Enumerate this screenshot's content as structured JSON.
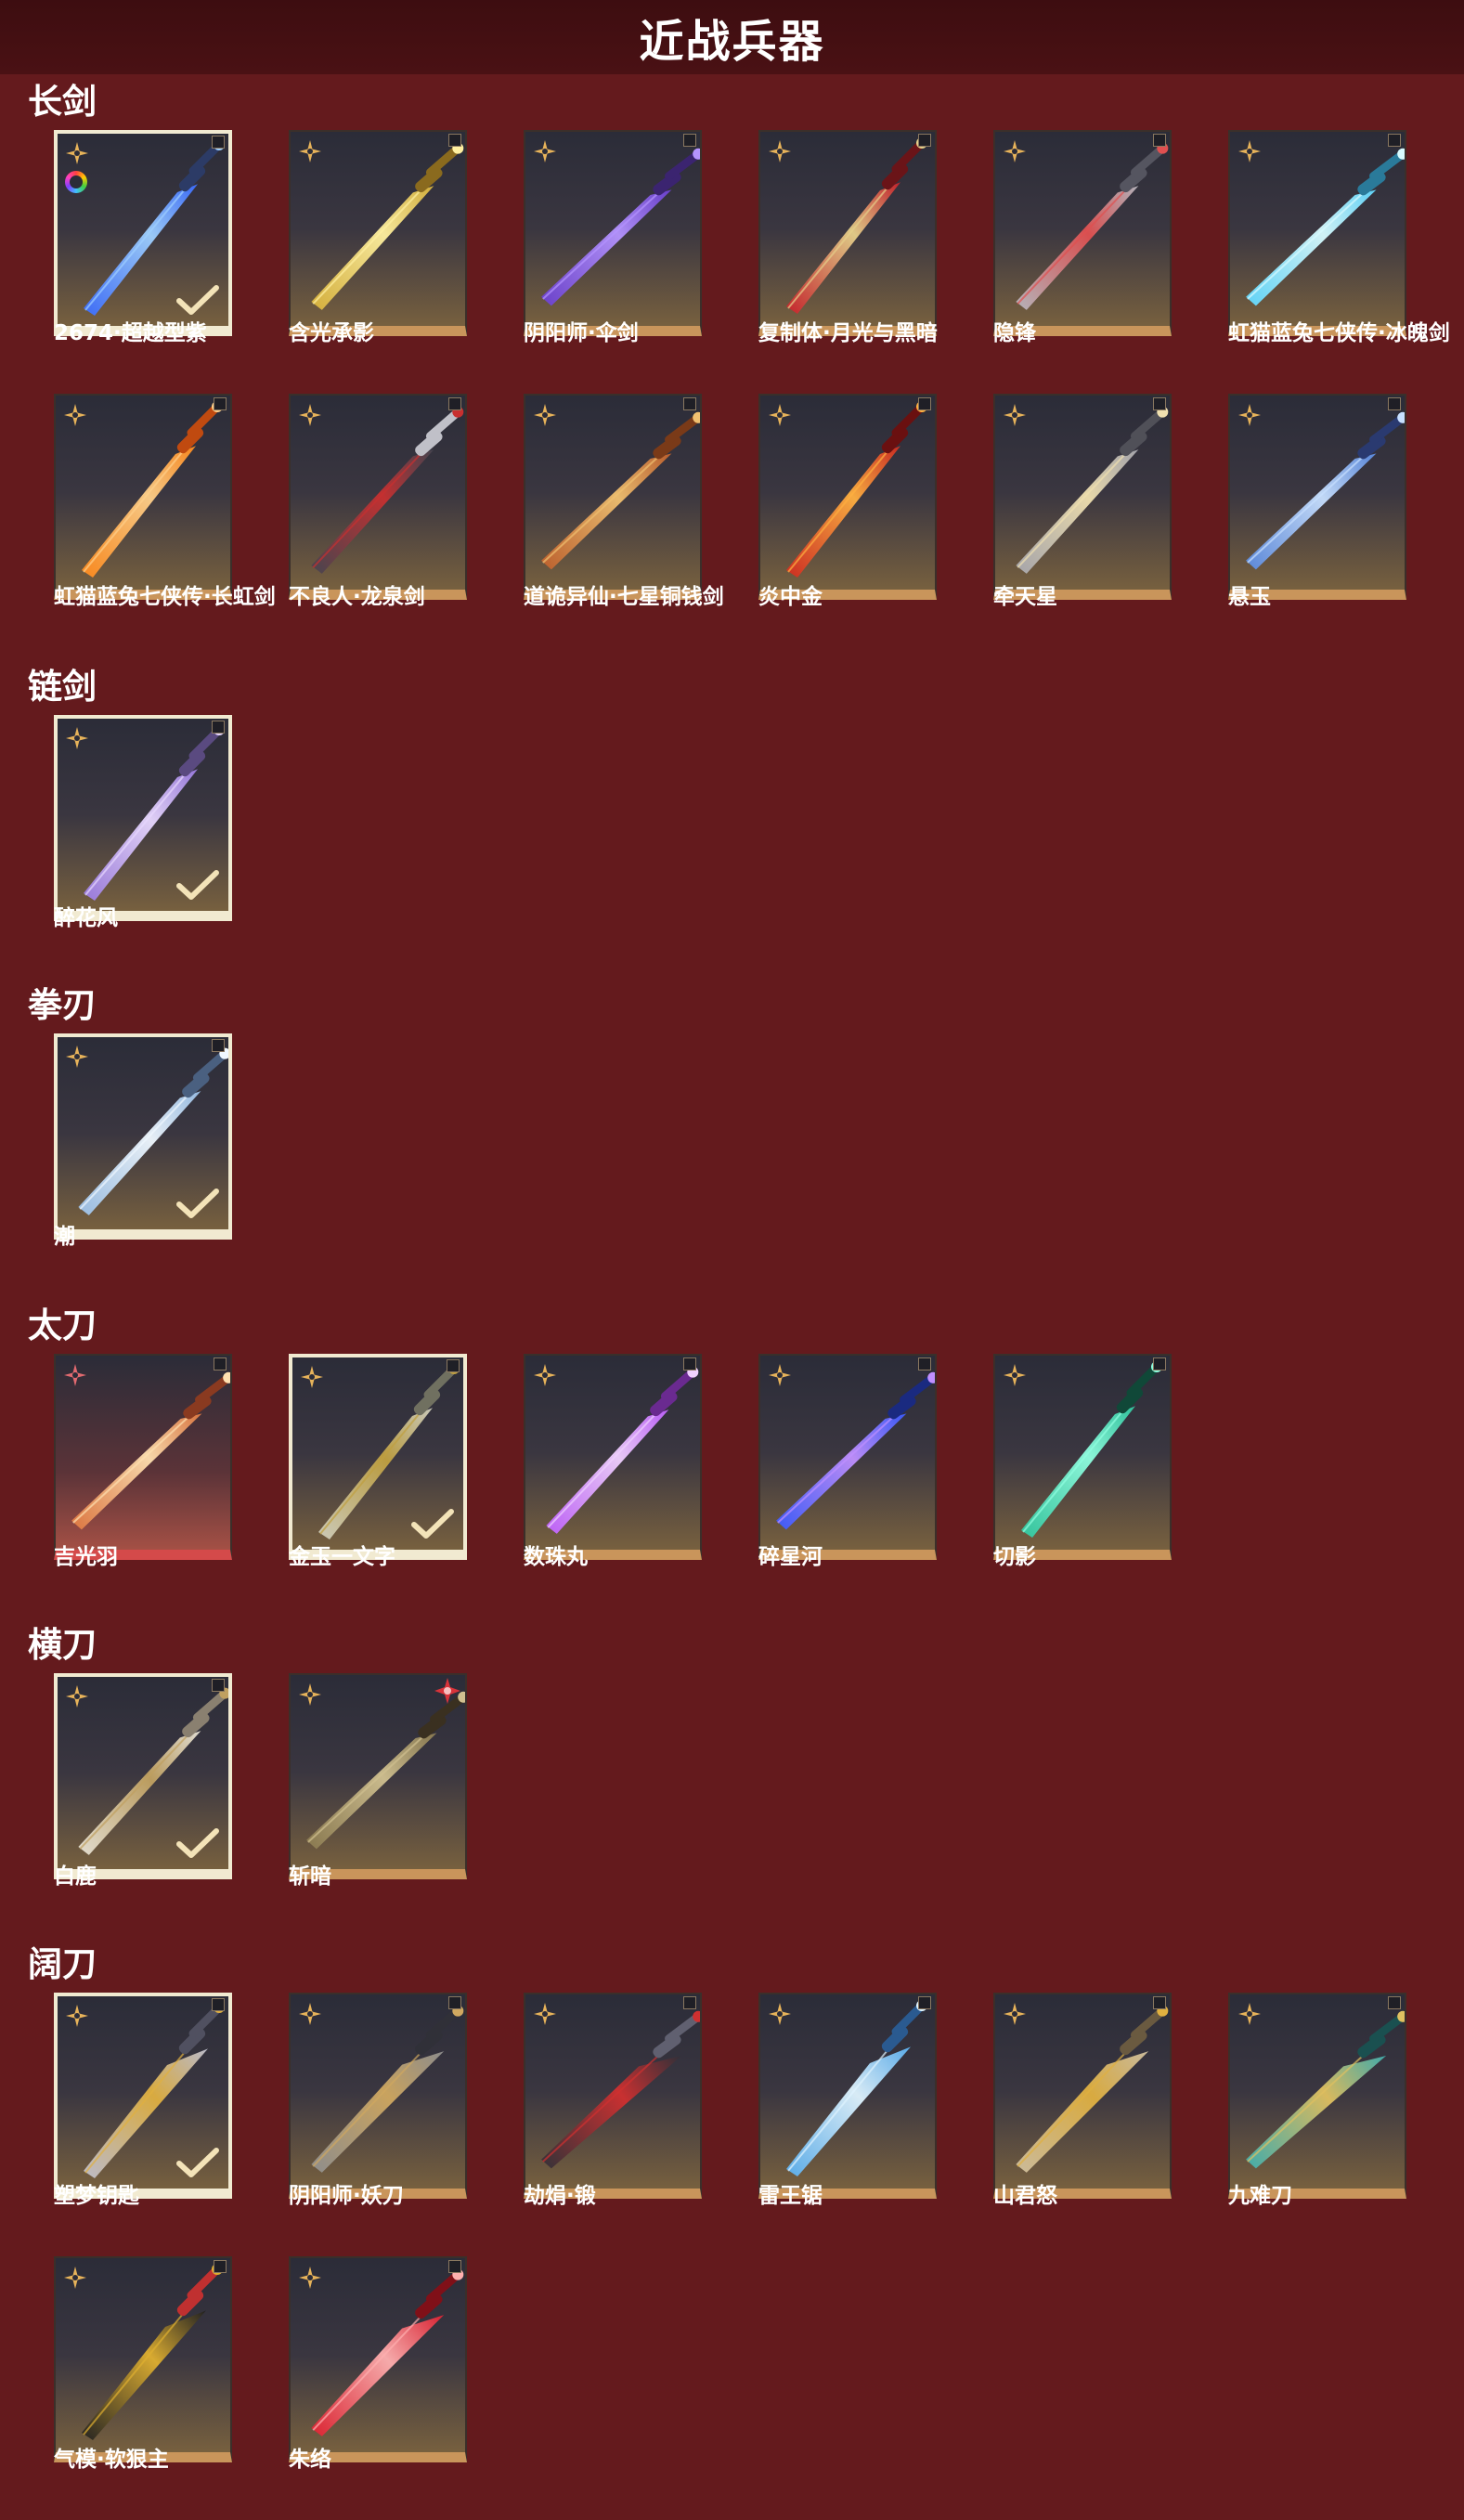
{
  "page": {
    "title": "近战兵器"
  },
  "colors": {
    "background": "#641a1d",
    "header": "#3d0d10",
    "card_border_gold": "#c9955b",
    "selected_border": "#f1ead1",
    "rarity_star_gold": "#e7b35a",
    "rarity_star_red": "#e26a70"
  },
  "sections": [
    {
      "title": "长剑",
      "items": [
        {
          "name": "2674·超越型紫",
          "selected": true,
          "icon": "blue-glow-sword-icon"
        },
        {
          "name": "含光承影",
          "selected": false,
          "icon": "golden-sword-icon"
        },
        {
          "name": "阴阳师·伞剑",
          "selected": false,
          "icon": "purple-umbrella-sword-icon"
        },
        {
          "name": "复制体·月光与黑暗",
          "selected": false,
          "icon": "red-rapier-icon"
        },
        {
          "name": "隐锋",
          "selected": false,
          "icon": "silver-katana-sword-icon"
        },
        {
          "name": "虹猫蓝兔七侠传·冰魄剑",
          "selected": false,
          "icon": "ice-sword-icon"
        },
        {
          "name": "虹猫蓝兔七侠传·长虹剑",
          "selected": false,
          "icon": "orange-fire-sword-icon"
        },
        {
          "name": "不良人·龙泉剑",
          "selected": false,
          "icon": "dark-ornate-sword-icon"
        },
        {
          "name": "道诡异仙·七星铜钱剑",
          "selected": false,
          "icon": "coin-sword-icon"
        },
        {
          "name": "炎中金",
          "selected": false,
          "icon": "flame-sword-icon"
        },
        {
          "name": "牵天星",
          "selected": false,
          "icon": "star-sword-icon"
        },
        {
          "name": "悬玉",
          "selected": false,
          "icon": "jade-blue-sword-icon"
        }
      ]
    },
    {
      "title": "链剑",
      "items": [
        {
          "name": "醉花风",
          "selected": true,
          "icon": "chain-sword-icon"
        }
      ]
    },
    {
      "title": "拳刃",
      "items": [
        {
          "name": "潮",
          "selected": true,
          "icon": "fist-blade-icon"
        }
      ]
    },
    {
      "title": "太刀",
      "items": [
        {
          "name": "吉光羽",
          "selected": false,
          "icon": "feather-tachi-icon",
          "rarity": "red"
        },
        {
          "name": "金玉一文字",
          "selected": true,
          "icon": "gold-jade-tachi-icon"
        },
        {
          "name": "数珠丸",
          "selected": false,
          "icon": "purple-tachi-icon"
        },
        {
          "name": "碎星河",
          "selected": false,
          "icon": "blue-tachi-icon"
        },
        {
          "name": "切影",
          "selected": false,
          "icon": "green-tachi-icon"
        }
      ]
    },
    {
      "title": "横刀",
      "items": [
        {
          "name": "白鹿",
          "selected": true,
          "icon": "white-deer-blade-icon"
        },
        {
          "name": "斩暗",
          "selected": false,
          "icon": "dark-blade-icon",
          "badge": "red"
        }
      ]
    },
    {
      "title": "阔刀",
      "items": [
        {
          "name": "塑梦钥匙",
          "selected": true,
          "icon": "key-broadsword-icon"
        },
        {
          "name": "阴阳师·妖刀",
          "selected": false,
          "icon": "yokai-broadsword-icon"
        },
        {
          "name": "劫焆·锻",
          "selected": false,
          "icon": "black-broadsword-icon"
        },
        {
          "name": "雷王锯",
          "selected": false,
          "icon": "thunder-saw-icon"
        },
        {
          "name": "山君怒",
          "selected": false,
          "icon": "tiger-broadsword-icon"
        },
        {
          "name": "九难刀",
          "selected": false,
          "icon": "teal-broadsword-icon"
        },
        {
          "name": "气模·软狠主",
          "selected": false,
          "icon": "gold-black-broadsword-icon"
        },
        {
          "name": "朱络",
          "selected": false,
          "icon": "red-butterfly-broadsword-icon"
        }
      ]
    }
  ]
}
